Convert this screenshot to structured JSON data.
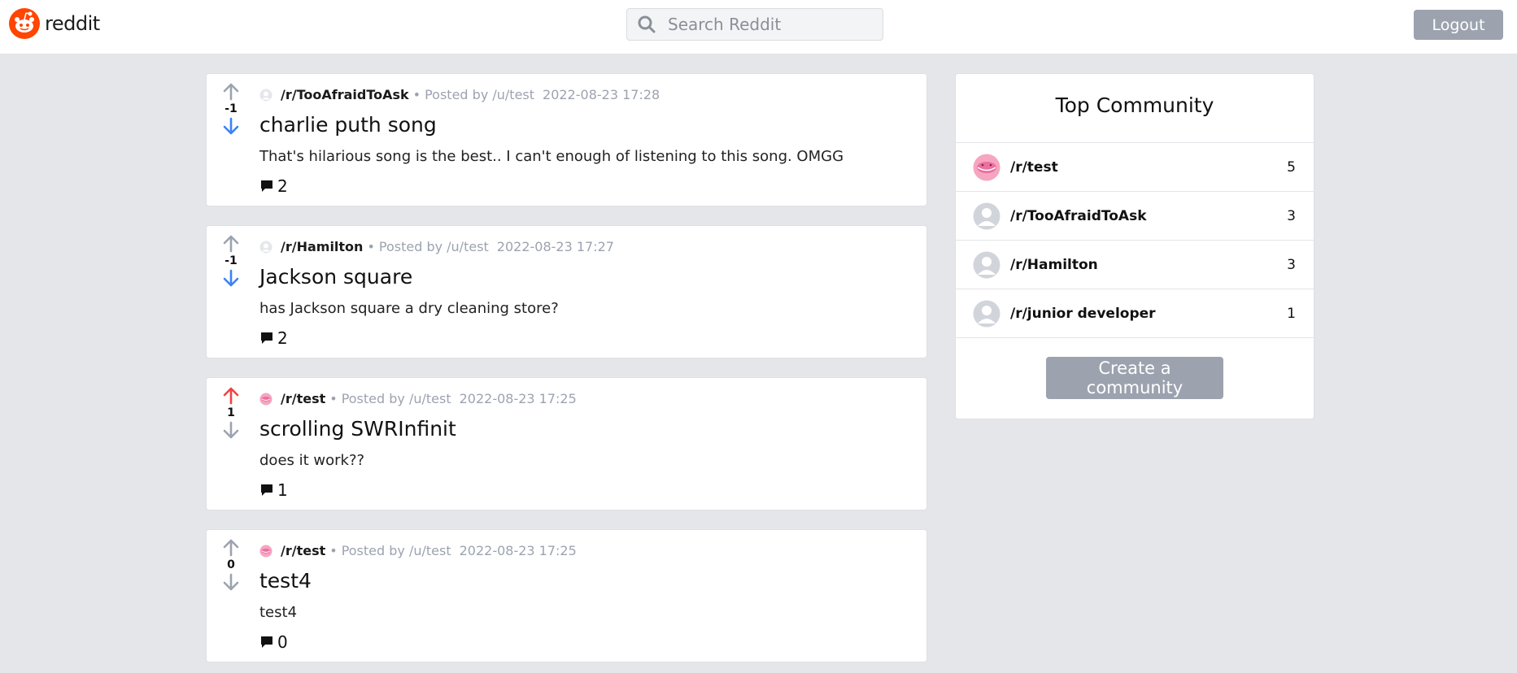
{
  "header": {
    "logo_text": "reddit",
    "search_placeholder": "Search Reddit",
    "logout_label": "Logout"
  },
  "colors": {
    "upvote_active": "#ef4444",
    "downvote_active": "#3b82f6",
    "vote_neutral": "#9ca3af",
    "button_gray": "#9ca3af",
    "brand": "#ff4500"
  },
  "posts": [
    {
      "subreddit": "/r/TooAfraidToAsk",
      "posted_by": "Posted by /u/test",
      "date": "2022-08-23 17:28",
      "score": "-1",
      "title": "charlie puth song",
      "body": "That's hilarious song is the best.. I can't enough of listening to this song. OMGG",
      "comments": "2"
    },
    {
      "subreddit": "/r/Hamilton",
      "posted_by": "Posted by /u/test",
      "date": "2022-08-23 17:27",
      "score": "-1",
      "title": "Jackson square",
      "body": "has Jackson square a dry cleaning store?",
      "comments": "2"
    },
    {
      "subreddit": "/r/test",
      "posted_by": "Posted by /u/test",
      "date": "2022-08-23 17:25",
      "score": "1",
      "title": "scrolling SWRInfinit",
      "body": "does it work??",
      "comments": "1"
    },
    {
      "subreddit": "/r/test",
      "posted_by": "Posted by /u/test",
      "date": "2022-08-23 17:25",
      "score": "0",
      "title": "test4",
      "body": "test4",
      "comments": "0"
    }
  ],
  "sidebar": {
    "title": "Top Community",
    "communities": [
      {
        "name": "/r/test",
        "count": "5"
      },
      {
        "name": "/r/TooAfraidToAsk",
        "count": "3"
      },
      {
        "name": "/r/Hamilton",
        "count": "3"
      },
      {
        "name": "/r/junior developer",
        "count": "1"
      }
    ],
    "create_label": "Create a community"
  }
}
